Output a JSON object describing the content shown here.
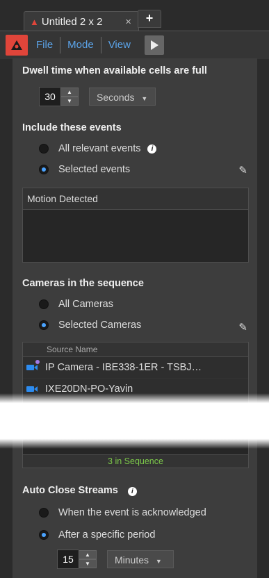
{
  "tab": {
    "title": "Untitled 2 x 2",
    "close": "×",
    "new_tab": "+"
  },
  "menu": {
    "items": [
      "File",
      "Mode",
      "View"
    ]
  },
  "dwell": {
    "title": "Dwell time when available cells are full",
    "value": "30",
    "unit": "Seconds"
  },
  "events": {
    "title": "Include these events",
    "option_all": "All relevant events",
    "option_selected": "Selected events",
    "selected": "selected",
    "list_header": "Motion Detected"
  },
  "cameras": {
    "title": "Cameras in the sequence",
    "option_all": "All Cameras",
    "option_selected": "Selected Cameras",
    "selected": "selected",
    "column_header": "Source Name",
    "rows": [
      "IP Camera - IBE338-1ER - TSBJ…",
      "IXE20DN-PO-Yavin"
    ],
    "sequence_count": "3 in Sequence"
  },
  "auto_close": {
    "title": "Auto Close Streams",
    "option_ack": "When the event is acknowledged",
    "option_period": "After a specific period",
    "selected": "period",
    "value": "15",
    "unit": "Minutes"
  },
  "colors": {
    "accent": "#4aa3ff",
    "alert": "#e0453a",
    "sequence_text": "#7cc84a",
    "camera_icon": "#2d8cf0"
  }
}
